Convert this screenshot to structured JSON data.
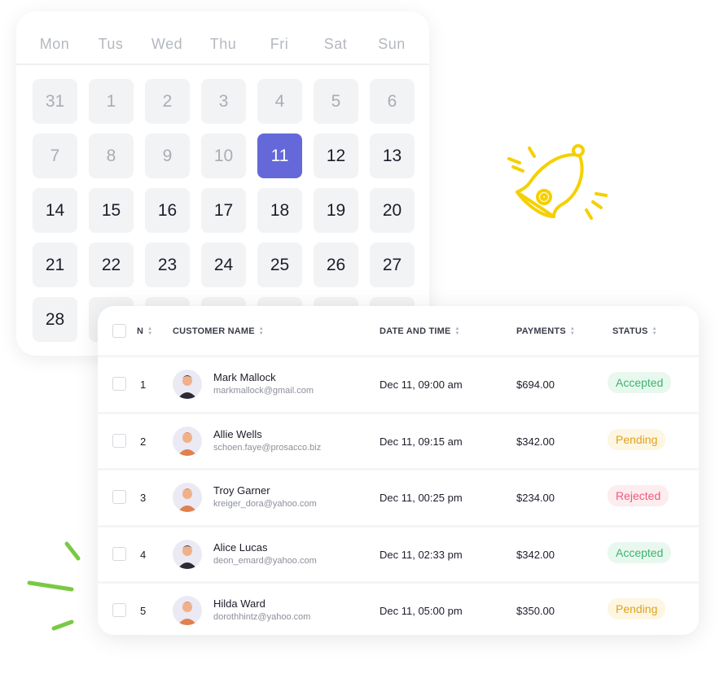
{
  "calendar": {
    "weekdays": [
      "Mon",
      "Tus",
      "Wed",
      "Thu",
      "Fri",
      "Sat",
      "Sun"
    ],
    "weeks": [
      [
        "31",
        "1",
        "2",
        "3",
        "4",
        "5",
        "6"
      ],
      [
        "7",
        "8",
        "9",
        "10",
        "11",
        "12",
        "13"
      ],
      [
        "14",
        "15",
        "16",
        "17",
        "18",
        "19",
        "20"
      ],
      [
        "21",
        "22",
        "23",
        "24",
        "25",
        "26",
        "27"
      ],
      [
        "28",
        "",
        "",
        "",
        "",
        "",
        ""
      ]
    ],
    "muted_through": "10",
    "selected": "11",
    "selected_color": "#6468d8"
  },
  "decor": {
    "bell_icon": "bell-icon",
    "bell_color": "#f5d000",
    "accent_strokes_color": "#7ac943"
  },
  "table": {
    "headers": {
      "n": "N",
      "customer": "CUSTOMER NAME",
      "date": "DATE AND TIME",
      "payments": "PAYMENTS",
      "status": "STATUS"
    },
    "rows": [
      {
        "n": "1",
        "name": "Mark Mallock",
        "email": "markmallock@gmail.com",
        "date": "Dec 11, 09:00 am",
        "payment": "$694.00",
        "status": "Accepted"
      },
      {
        "n": "2",
        "name": "Allie Wells",
        "email": "schoen.faye@prosacco.biz",
        "date": "Dec 11, 09:15 am",
        "payment": "$342.00",
        "status": "Pending"
      },
      {
        "n": "3",
        "name": "Troy Garner",
        "email": "kreiger_dora@yahoo.com",
        "date": "Dec 11, 00:25 pm",
        "payment": "$234.00",
        "status": "Rejected"
      },
      {
        "n": "4",
        "name": "Alice Lucas",
        "email": "deon_emard@yahoo.com",
        "date": "Dec 11, 02:33 pm",
        "payment": "$342.00",
        "status": "Accepted"
      },
      {
        "n": "5",
        "name": "Hilda Ward",
        "email": "dorothhintz@yahoo.com",
        "date": "Dec 11, 05:00 pm",
        "payment": "$350.00",
        "status": "Pending"
      }
    ],
    "status_colors": {
      "Accepted": {
        "fg": "#3cb46e",
        "bg": "#e9f8ef"
      },
      "Pending": {
        "fg": "#e0a21a",
        "bg": "#fdf6e3"
      },
      "Rejected": {
        "fg": "#ef5a7a",
        "bg": "#fdecf0"
      }
    }
  }
}
